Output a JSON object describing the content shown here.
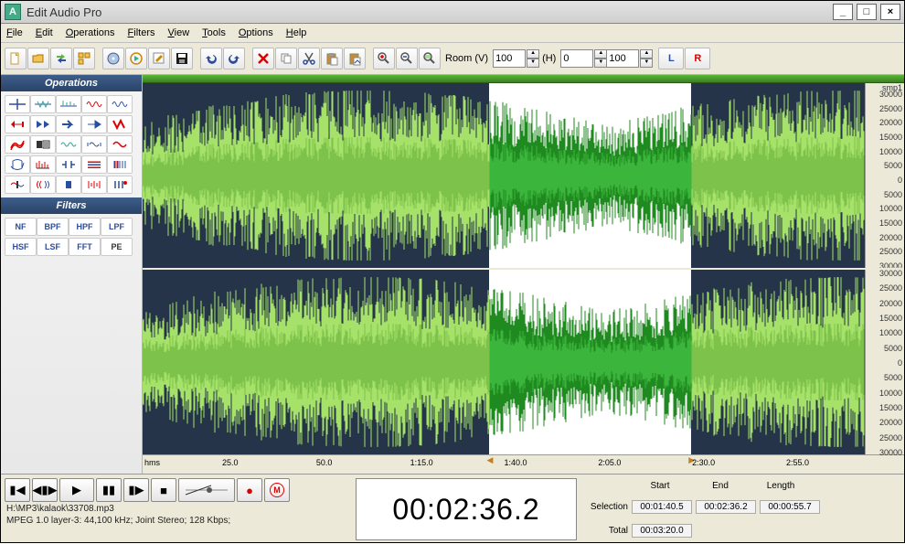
{
  "title": "Edit Audio Pro",
  "app_icon_letter": "A",
  "titlebar": {
    "min": "_",
    "max": "□",
    "close": "×"
  },
  "menu": [
    "File",
    "Edit",
    "Operations",
    "Filters",
    "View",
    "Tools",
    "Options",
    "Help"
  ],
  "toolbar": {
    "room_label": "Room (V)",
    "room_v": "100",
    "h_label": "(H)",
    "h_value": "0",
    "h_value2": "100",
    "lr_l": "L",
    "lr_r": "R"
  },
  "sidepanels": {
    "ops_title": "Operations",
    "filters_title": "Filters",
    "filter_labels": [
      "NF",
      "BPF",
      "HPF",
      "LPF",
      "HSF",
      "LSF",
      "FFT",
      "PE"
    ]
  },
  "amplitude": {
    "unit": "smp1",
    "ticks": [
      "30000",
      "25000",
      "20000",
      "15000",
      "10000",
      "5000",
      "0",
      "5000",
      "10000",
      "15000",
      "20000",
      "25000",
      "30000"
    ]
  },
  "time_ruler": {
    "unit": "hms",
    "ticks": [
      "25.0",
      "50.0",
      "1:15.0",
      "1:40.0",
      "2:05.0",
      "2:30.0",
      "2:55.0"
    ]
  },
  "transport": {
    "file_path": "H:\\MP3\\kalaok\\33708.mp3",
    "format_info": "MPEG 1.0 layer-3: 44,100 kHz; Joint Stereo; 128 Kbps;",
    "m_label": "M"
  },
  "bigtime": "00:02:36.2",
  "info": {
    "start_label": "Start",
    "end_label": "End",
    "length_label": "Length",
    "selection_label": "Selection",
    "total_label": "Total",
    "sel_start": "00:01:40.5",
    "sel_end": "00:02:36.2",
    "sel_length": "00:00:55.7",
    "total": "00:03:20.0"
  }
}
